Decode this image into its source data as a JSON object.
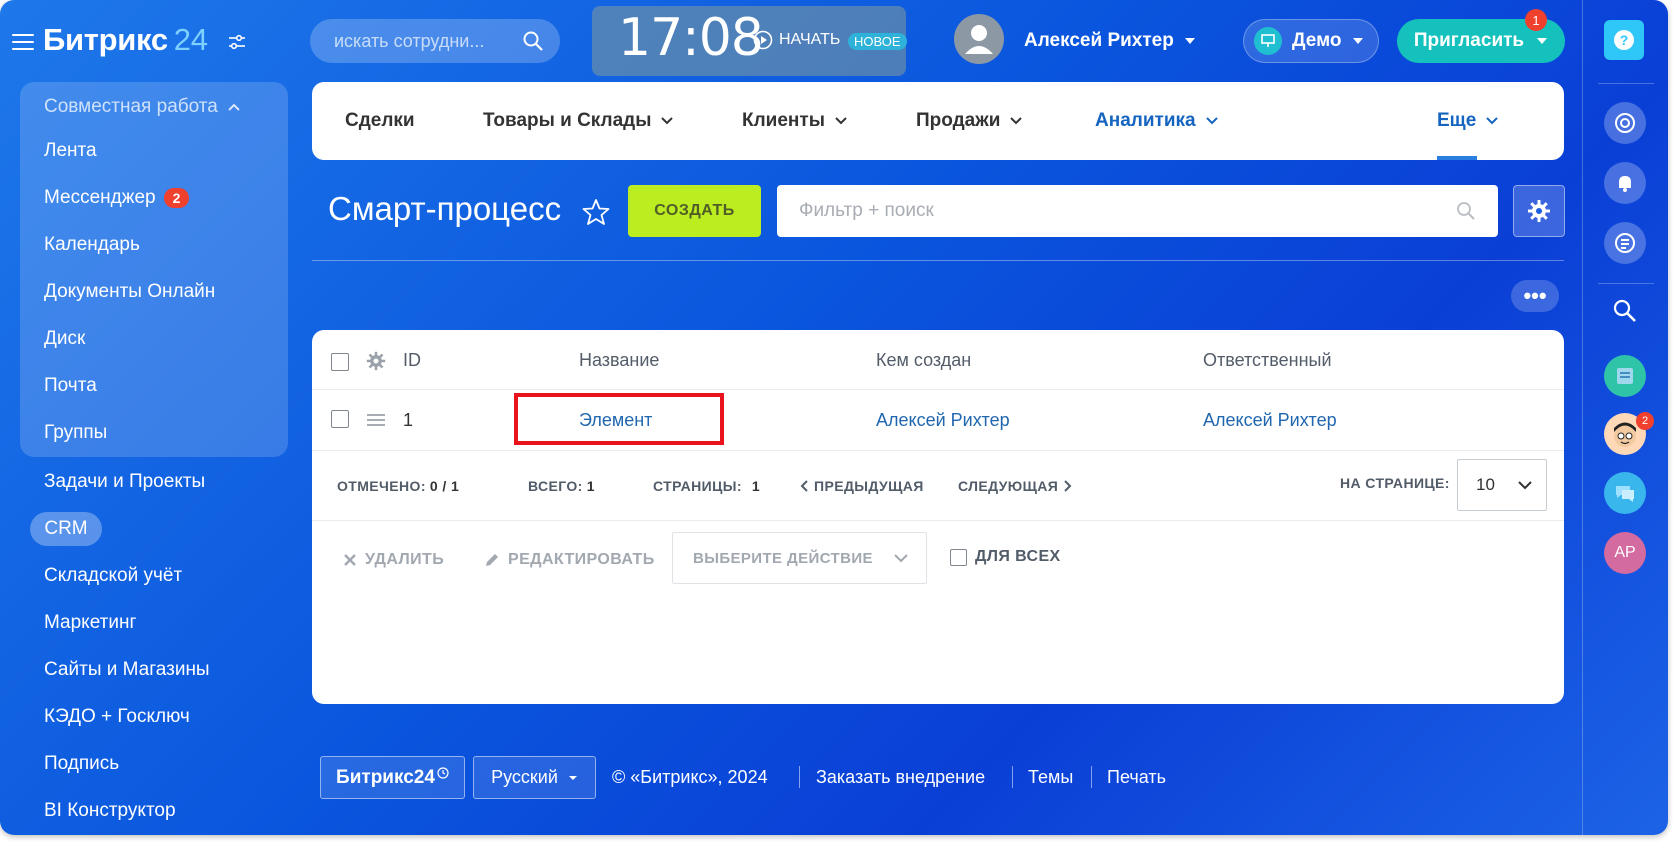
{
  "colors": {
    "accent": "#2067b0",
    "create_button": "#bbed21",
    "badge": "#f0402e",
    "invite": "#15c1bc",
    "highlight": "#e8131b"
  },
  "sidebar": {
    "logo_text": "Битрикс",
    "logo_num": "24",
    "group_title": "Совместная работа",
    "group_items": [
      {
        "label": "Лента"
      },
      {
        "label": "Мессенджер",
        "badge": "2"
      },
      {
        "label": "Календарь"
      },
      {
        "label": "Документы Онлайн"
      },
      {
        "label": "Диск"
      },
      {
        "label": "Почта"
      },
      {
        "label": "Группы"
      }
    ],
    "items": [
      {
        "label": "Задачи и Проекты"
      },
      {
        "label": "CRM",
        "active": true
      },
      {
        "label": "Складской учёт"
      },
      {
        "label": "Маркетинг"
      },
      {
        "label": "Сайты и Магазины"
      },
      {
        "label": "КЭДО + Госключ"
      },
      {
        "label": "Подпись"
      },
      {
        "label": "BI Конструктор"
      }
    ]
  },
  "header": {
    "search_placeholder": "искать сотрудни...",
    "time": "17:08",
    "start_label": "НАЧАТЬ",
    "new_badge": "НОВОЕ",
    "user_name": "Алексей Рихтер",
    "demo_label": "Демо",
    "invite_label": "Пригласить",
    "invite_badge": "1"
  },
  "topmenu": {
    "items": [
      {
        "label": "Сделки",
        "has_chevron": false
      },
      {
        "label": "Товары и Склады",
        "has_chevron": true
      },
      {
        "label": "Клиенты",
        "has_chevron": true
      },
      {
        "label": "Продажи",
        "has_chevron": true
      },
      {
        "label": "Аналитика",
        "has_chevron": true
      },
      {
        "label": "Еще",
        "has_chevron": true
      }
    ]
  },
  "page": {
    "title": "Смарт-процесс",
    "create_label": "СОЗДАТЬ",
    "filter_placeholder": "Фильтр + поиск"
  },
  "grid": {
    "columns": [
      "ID",
      "Название",
      "Кем создан",
      "Ответственный"
    ],
    "rows": [
      {
        "id": "1",
        "name": "Элемент",
        "created_by": "Алексей Рихтер",
        "responsible": "Алексей Рихтер"
      }
    ],
    "pagination": {
      "selected_label": "ОТМЕЧЕНО:",
      "selected_value": "0 / 1",
      "total_label": "ВСЕГО:",
      "total_value": "1",
      "pages_label": "СТРАНИЦЫ:",
      "pages_value": "1",
      "prev_label": "ПРЕДЫДУЩАЯ",
      "next_label": "СЛЕДУЮЩАЯ",
      "per_page_label": "НА СТРАНИЦЕ:",
      "per_page_value": "10"
    },
    "actions": {
      "delete_label": "УДАЛИТЬ",
      "edit_label": "РЕДАКТИРОВАТЬ",
      "select_action_label": "ВЫБЕРИТЕ ДЕЙСТВИЕ",
      "for_all_label": "ДЛЯ ВСЕХ"
    }
  },
  "rightbar": {
    "help_label": "?",
    "notify_badge": "2",
    "user_initials": "АР"
  },
  "footer": {
    "logo": "Битрикс24",
    "language": "Русский",
    "copyright": "© «Битрикс», 2024",
    "links": [
      "Заказать внедрение",
      "Темы",
      "Печать"
    ]
  }
}
